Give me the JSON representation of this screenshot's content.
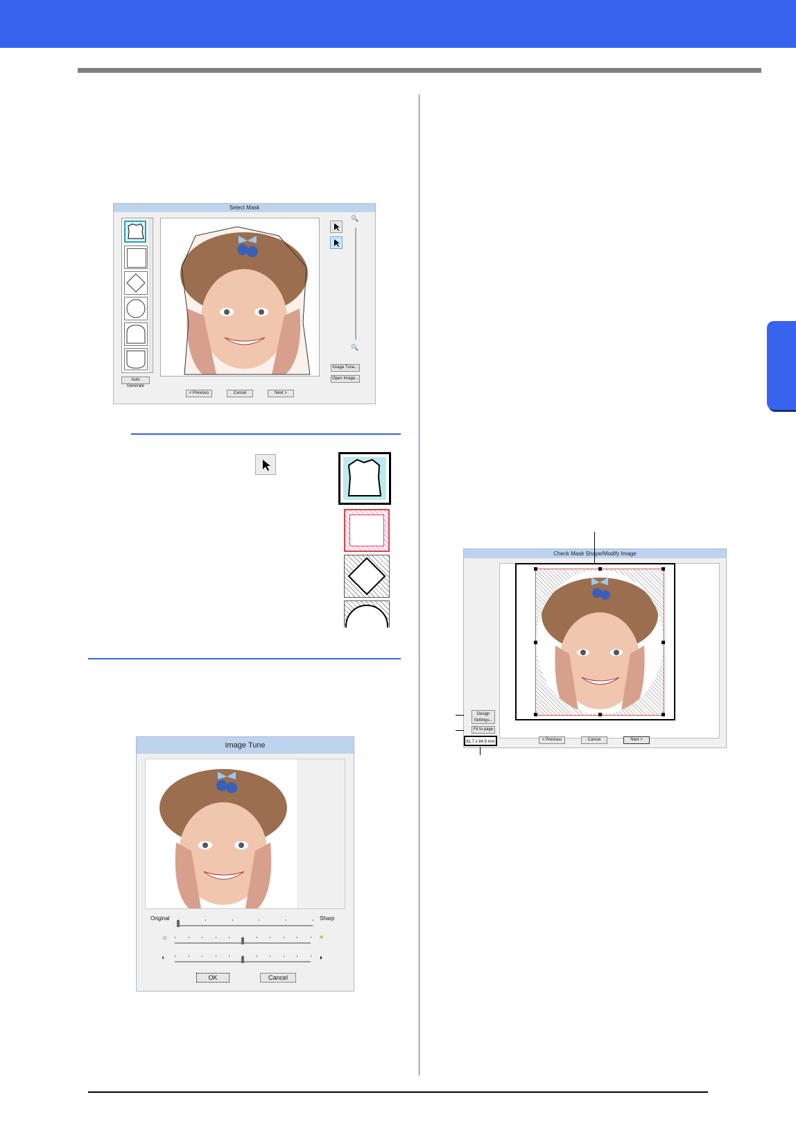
{
  "select_mask": {
    "title": "Select Mask",
    "auto_generate": "Auto Generate",
    "image_tune": "Image Tune...",
    "open_image": "Open Image...",
    "previous": "< Previous",
    "cancel": "Cancel",
    "next": "Next >"
  },
  "image_tune": {
    "title": "Image Tune",
    "original": "Original",
    "sharp": "Sharp",
    "ok": "OK",
    "cancel": "Cancel",
    "detail_slider_value": 0,
    "brightness_slider_value": 0.5,
    "contrast_slider_value": 0.5
  },
  "check_mask": {
    "title": "Check Mask Shape/Modify Image",
    "design_settings": "Design Settings...",
    "fit_to_page": "Fit to page",
    "size_readout": "81.7 x 84.9 mm",
    "previous": "< Previous",
    "cancel": "Cancel",
    "next": "Next >"
  },
  "colors": {
    "header": "#3763ee",
    "rule": "#3a62d8",
    "dialog_bg": "#f0f0f0",
    "dialog_title": "#bdd3ee"
  }
}
